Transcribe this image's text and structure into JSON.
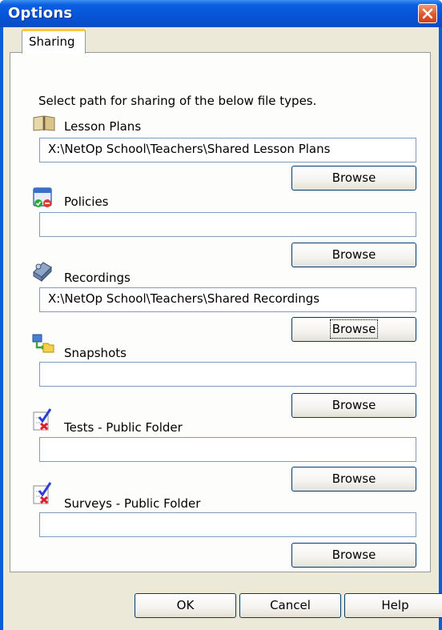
{
  "window": {
    "title": "Options"
  },
  "tabs": [
    {
      "label": "Sharing"
    }
  ],
  "description": "Select path for sharing of the below file types.",
  "rows": [
    {
      "label": "Lesson Plans",
      "icon": "book-icon",
      "value": "X:\\NetOp School\\Teachers\\Shared Lesson Plans",
      "button": "Browse"
    },
    {
      "label": "Policies",
      "icon": "policy-icon",
      "value": "",
      "button": "Browse"
    },
    {
      "label": "Recordings",
      "icon": "video-camera-icon",
      "value": "X:\\NetOp School\\Teachers\\Shared Recordings",
      "button": "Browse"
    },
    {
      "label": "Snapshots",
      "icon": "snapshot-icon",
      "value": "",
      "button": "Browse"
    },
    {
      "label": "Tests - Public Folder",
      "icon": "test-checklist-icon",
      "value": "",
      "button": "Browse"
    },
    {
      "label": "Surveys - Public Folder",
      "icon": "survey-checklist-icon",
      "value": "",
      "button": "Browse"
    }
  ],
  "footer": {
    "ok": "OK",
    "cancel": "Cancel",
    "help": "Help"
  },
  "colors": {
    "titlebar": "#0653d6",
    "dialog_bg": "#ece9d8",
    "tab_accent": "#ffc83c",
    "close": "#e2562a"
  }
}
